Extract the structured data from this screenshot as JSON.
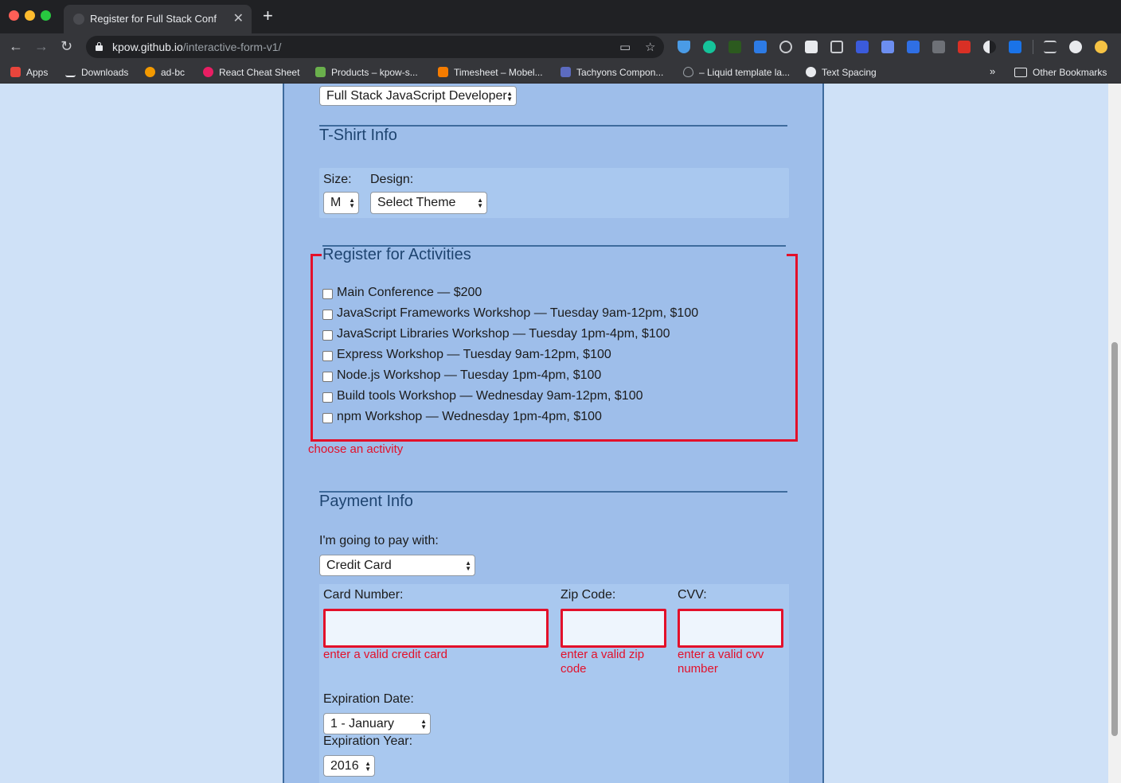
{
  "browser": {
    "tab_title": "Register for Full Stack Conf",
    "url_host": "kpow.github.io",
    "url_path": "/interactive-form-v1/",
    "bookmarks": [
      {
        "label": "Apps",
        "icon": "apps-grid-icon",
        "color": "#e8453c"
      },
      {
        "label": "Downloads",
        "icon": "download-icon",
        "color": "#e8eaed"
      },
      {
        "label": "ad-bc",
        "icon": "ad-bc-icon",
        "color": "#f29900"
      },
      {
        "label": "React Cheat Sheet",
        "icon": "react-icon",
        "color": "#e91e63"
      },
      {
        "label": "Products – kpow-s...",
        "icon": "products-icon",
        "color": "#6ab04c"
      },
      {
        "label": "Timesheet – Mobel...",
        "icon": "timesheet-icon",
        "color": "#f57c00"
      },
      {
        "label": "Tachyons Compon...",
        "icon": "tachyons-icon",
        "color": "#5c6bc0"
      },
      {
        "label": "– Liquid template la...",
        "icon": "liquid-drop-icon",
        "color": "#9aa0a6"
      },
      {
        "label": "Text Spacing",
        "icon": "text-spacing-icon",
        "color": "#e8eaed"
      }
    ],
    "other_bookmarks": "Other Bookmarks"
  },
  "form": {
    "job_role_select": "Full Stack JavaScript Developer",
    "tshirt": {
      "title": "T-Shirt Info",
      "size_label": "Size:",
      "size_value": "M",
      "design_label": "Design:",
      "design_value": "Select Theme"
    },
    "activities": {
      "title": "Register for Activities",
      "items": [
        "Main Conference — $200",
        "JavaScript Frameworks Workshop — Tuesday 9am-12pm, $100",
        "JavaScript Libraries Workshop — Tuesday 1pm-4pm, $100",
        "Express Workshop — Tuesday 9am-12pm, $100",
        "Node.js Workshop — Tuesday 1pm-4pm, $100",
        "Build tools Workshop — Wednesday 9am-12pm, $100",
        "npm Workshop — Wednesday 1pm-4pm, $100"
      ],
      "error": "choose an activity"
    },
    "payment": {
      "title": "Payment Info",
      "pay_with_label": "I'm going to pay with:",
      "pay_with_value": "Credit Card",
      "card_number_label": "Card Number:",
      "card_number_value": "",
      "card_number_error": "enter a valid credit card",
      "zip_label": "Zip Code:",
      "zip_value": "",
      "zip_error_line1": "enter a valid zip",
      "zip_error_line2": "code",
      "cvv_label": "CVV:",
      "cvv_value": "",
      "cvv_error_line1": "enter a valid cvv",
      "cvv_error_line2": "number",
      "exp_date_label": "Expiration Date:",
      "exp_date_value": "1 - January",
      "exp_year_label": "Expiration Year:",
      "exp_year_value": "2016"
    }
  },
  "colors": {
    "error": "#e3102a",
    "page_background": "#cfe1f7",
    "form_background": "#9ebeea",
    "heading": "#1e4470"
  }
}
